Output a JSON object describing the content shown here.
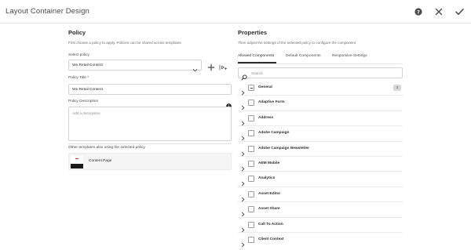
{
  "header": {
    "title": "Layout Container Design",
    "icons": [
      "help-icon",
      "close-icon",
      "checkmark-icon"
    ]
  },
  "policy": {
    "heading": "Policy",
    "hint": "First choose a policy to apply. Policies can be shared across templates",
    "select_label": "Select policy",
    "selected_policy": "We.Retail Content",
    "title_label": "Policy Title *",
    "title_value": "We.Retail Content",
    "description_label": "Policy Description",
    "description_placeholder": "Add a description",
    "other_templates_label": "Other templates also using the selected policy",
    "templates": [
      {
        "name": "Content Page"
      }
    ]
  },
  "properties": {
    "heading": "Properties",
    "hint": "Then adjust the settings of the selected policy to configure the component",
    "tabs": [
      {
        "label": "Allowed Components",
        "active": true
      },
      {
        "label": "Default Components",
        "active": false
      },
      {
        "label": "Responsive Settings",
        "active": false
      }
    ],
    "search_placeholder": "Search",
    "components": [
      {
        "name": "General",
        "count": "3",
        "state": "mixed"
      },
      {
        "name": "Adaptive Form"
      },
      {
        "name": "Address"
      },
      {
        "name": "Adobe Campaign"
      },
      {
        "name": "Adobe Campaign Newsletter"
      },
      {
        "name": "AEM Mobile"
      },
      {
        "name": "Analytics"
      },
      {
        "name": "Asset Editor"
      },
      {
        "name": "Asset Share"
      },
      {
        "name": "Call To Action"
      },
      {
        "name": "Client Context"
      }
    ]
  }
}
